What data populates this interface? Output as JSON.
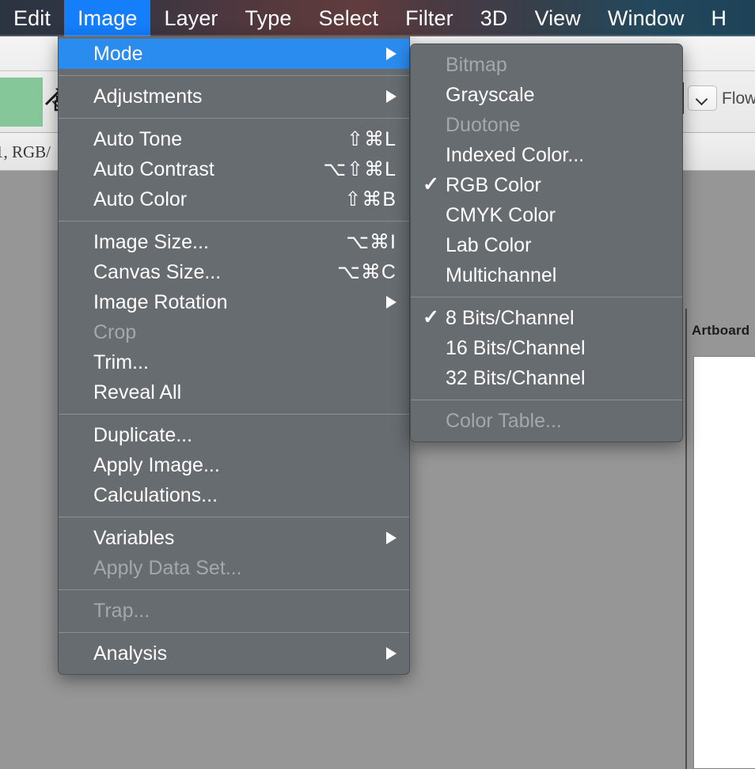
{
  "menubar": {
    "items": [
      {
        "label": "Edit",
        "active": false
      },
      {
        "label": "Image",
        "active": true
      },
      {
        "label": "Layer",
        "active": false
      },
      {
        "label": "Type",
        "active": false
      },
      {
        "label": "Select",
        "active": false
      },
      {
        "label": "Filter",
        "active": false
      },
      {
        "label": "3D",
        "active": false
      },
      {
        "label": "View",
        "active": false
      },
      {
        "label": "Window",
        "active": false
      },
      {
        "label": "H",
        "active": false
      }
    ]
  },
  "options_bar": {
    "flow_label": "Flow",
    "chevron_icon": "chevron-down-icon",
    "airbrush_icon": "airbrush-icon",
    "swatch_color": "#86c79a"
  },
  "document_tab": {
    "title": "1, RGB/"
  },
  "canvas": {
    "artboard_label": "Artboard",
    "background_color": "#969696",
    "artboard_color": "#ffffff"
  },
  "image_menu": {
    "groups": [
      [
        {
          "label": "Mode",
          "shortcut": "",
          "submenu": true,
          "checked": false,
          "disabled": false,
          "highlight": true
        }
      ],
      [
        {
          "label": "Adjustments",
          "shortcut": "",
          "submenu": true,
          "checked": false,
          "disabled": false,
          "highlight": false
        }
      ],
      [
        {
          "label": "Auto Tone",
          "shortcut": "⇧⌘L",
          "submenu": false,
          "checked": false,
          "disabled": false,
          "highlight": false
        },
        {
          "label": "Auto Contrast",
          "shortcut": "⌥⇧⌘L",
          "submenu": false,
          "checked": false,
          "disabled": false,
          "highlight": false
        },
        {
          "label": "Auto Color",
          "shortcut": "⇧⌘B",
          "submenu": false,
          "checked": false,
          "disabled": false,
          "highlight": false
        }
      ],
      [
        {
          "label": "Image Size...",
          "shortcut": "⌥⌘I",
          "submenu": false,
          "checked": false,
          "disabled": false,
          "highlight": false
        },
        {
          "label": "Canvas Size...",
          "shortcut": "⌥⌘C",
          "submenu": false,
          "checked": false,
          "disabled": false,
          "highlight": false
        },
        {
          "label": "Image Rotation",
          "shortcut": "",
          "submenu": true,
          "checked": false,
          "disabled": false,
          "highlight": false
        },
        {
          "label": "Crop",
          "shortcut": "",
          "submenu": false,
          "checked": false,
          "disabled": true,
          "highlight": false
        },
        {
          "label": "Trim...",
          "shortcut": "",
          "submenu": false,
          "checked": false,
          "disabled": false,
          "highlight": false
        },
        {
          "label": "Reveal All",
          "shortcut": "",
          "submenu": false,
          "checked": false,
          "disabled": false,
          "highlight": false
        }
      ],
      [
        {
          "label": "Duplicate...",
          "shortcut": "",
          "submenu": false,
          "checked": false,
          "disabled": false,
          "highlight": false
        },
        {
          "label": "Apply Image...",
          "shortcut": "",
          "submenu": false,
          "checked": false,
          "disabled": false,
          "highlight": false
        },
        {
          "label": "Calculations...",
          "shortcut": "",
          "submenu": false,
          "checked": false,
          "disabled": false,
          "highlight": false
        }
      ],
      [
        {
          "label": "Variables",
          "shortcut": "",
          "submenu": true,
          "checked": false,
          "disabled": false,
          "highlight": false
        },
        {
          "label": "Apply Data Set...",
          "shortcut": "",
          "submenu": false,
          "checked": false,
          "disabled": true,
          "highlight": false
        }
      ],
      [
        {
          "label": "Trap...",
          "shortcut": "",
          "submenu": false,
          "checked": false,
          "disabled": true,
          "highlight": false
        }
      ],
      [
        {
          "label": "Analysis",
          "shortcut": "",
          "submenu": true,
          "checked": false,
          "disabled": false,
          "highlight": false
        }
      ]
    ]
  },
  "mode_submenu": {
    "groups": [
      [
        {
          "label": "Bitmap",
          "checked": false,
          "disabled": true
        },
        {
          "label": "Grayscale",
          "checked": false,
          "disabled": false
        },
        {
          "label": "Duotone",
          "checked": false,
          "disabled": true
        },
        {
          "label": "Indexed Color...",
          "checked": false,
          "disabled": false
        },
        {
          "label": "RGB Color",
          "checked": true,
          "disabled": false
        },
        {
          "label": "CMYK Color",
          "checked": false,
          "disabled": false
        },
        {
          "label": "Lab Color",
          "checked": false,
          "disabled": false
        },
        {
          "label": "Multichannel",
          "checked": false,
          "disabled": false
        }
      ],
      [
        {
          "label": "8 Bits/Channel",
          "checked": true,
          "disabled": false
        },
        {
          "label": "16 Bits/Channel",
          "checked": false,
          "disabled": false
        },
        {
          "label": "32 Bits/Channel",
          "checked": false,
          "disabled": false
        }
      ],
      [
        {
          "label": "Color Table...",
          "checked": false,
          "disabled": true
        }
      ]
    ]
  },
  "glyphs": {
    "check": "✓",
    "submenu_arrow": "▶"
  }
}
